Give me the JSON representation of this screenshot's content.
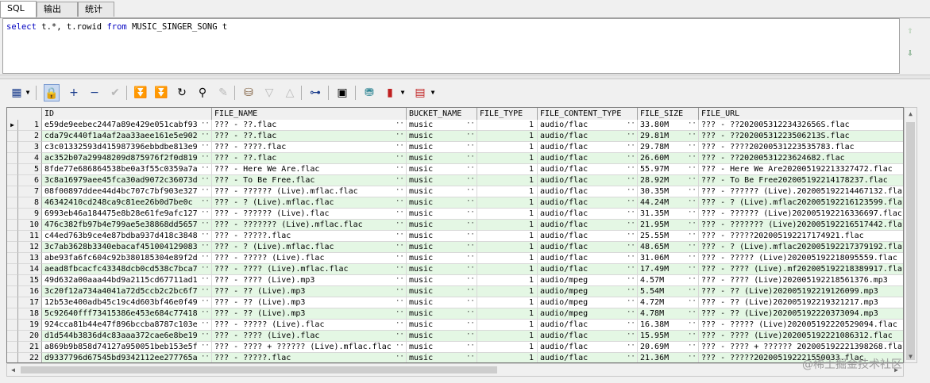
{
  "tabs": [
    "SQL",
    "输出",
    "统计"
  ],
  "sql": {
    "kw_select": "select",
    "part1": " t.*, t.rowid ",
    "kw_from": "from",
    "part2": " MUSIC_SINGER_SONG t"
  },
  "editor_icons": [
    "up-arrow-icon",
    "down-arrow-icon"
  ],
  "colors": {
    "accent": "#2a7a3a",
    "row_alt": "#e4f7e4",
    "keyword": "#0000c0"
  },
  "columns": [
    "ID",
    "FILE_NAME",
    "BUCKET_NAME",
    "FILE_TYPE",
    "FILE_CONTENT_TYPE",
    "FILE_SIZE",
    "FILE_URL"
  ],
  "rows": [
    [
      "1",
      "e59de9eebec2447a89e429e051cabf93",
      "??? - ??.flac",
      "music",
      "1",
      "audio/flac",
      "33.80M",
      "??? - ??20200531223432656S.flac"
    ],
    [
      "2",
      "cda79c440f1a4af2aa33aee161e5e902",
      "??? - ??.flac",
      "music",
      "1",
      "audio/flac",
      "29.81M",
      "??? - ??20200531223506213S.flac"
    ],
    [
      "3",
      "c3c01332593d415987396ebbdbe813e9",
      "??? - ????.flac",
      "music",
      "1",
      "audio/flac",
      "29.78M",
      "??? - ????20200531223535783.flac"
    ],
    [
      "4",
      "ac352b07a29948209d875976f2f0d819",
      "??? - ??.flac",
      "music",
      "1",
      "audio/flac",
      "26.60M",
      "??? - ??20200531223624682.flac"
    ],
    [
      "5",
      "8fde77e686864538be0a3f55c0359a7a",
      "??? - Here We Are.flac",
      "music",
      "1",
      "audio/flac",
      "55.97M",
      "??? - Here We Are202005192213327472.flac"
    ],
    [
      "6",
      "3c8a16979aee45fca30ad9072c36073d",
      "??? - To Be Free.flac",
      "music",
      "1",
      "audio/flac",
      "28.92M",
      "??? - To Be Free202005192214178237.flac"
    ],
    [
      "7",
      "08f00897ddee44d4bc707c7bf903e327",
      "??? - ?????? (Live).mflac.flac",
      "music",
      "1",
      "audio/flac",
      "30.35M",
      "??? - ?????? (Live).202005192214467132.fla"
    ],
    [
      "8",
      "46342410cd248ca9c81ee26b0d7be0c",
      "??? - ? (Live).mflac.flac",
      "music",
      "1",
      "audio/flac",
      "44.24M",
      "??? - ? (Live).mflac202005192216123599.fla"
    ],
    [
      "9",
      "6993eb46a184475e8b28e61fe9afc127",
      "??? - ?????? (Live).flac",
      "music",
      "1",
      "audio/flac",
      "31.35M",
      "??? - ?????? (Live)202005192216336697.flac"
    ],
    [
      "10",
      "476c382fb97b4e799ae5e38868dd5657",
      "??? - ??????? (Live).mflac.flac",
      "music",
      "1",
      "audio/flac",
      "21.95M",
      "??? - ??????? (Live)202005192216517442.fla"
    ],
    [
      "11",
      "c44ed763b9ce4e87bdba937d418c3848",
      "??? - ?????.flac",
      "music",
      "1",
      "audio/flac",
      "25.55M",
      "??? - ?????202005192217174921.flac"
    ],
    [
      "12",
      "3c7ab3628b3340ebacaf451004129083",
      "??? - ? (Live).mflac.flac",
      "music",
      "1",
      "audio/flac",
      "48.65M",
      "??? - ? (Live).mflac202005192217379192.fla"
    ],
    [
      "13",
      "abe93fa6fc604c92b380185304e89f2d",
      "??? - ????? (Live).flac",
      "music",
      "1",
      "audio/flac",
      "31.06M",
      "??? - ????? (Live)202005192218095559.flac"
    ],
    [
      "14",
      "aead8fbcacfc43348dcb0cd538c7bca7",
      "??? - ???? (Live).mflac.flac",
      "music",
      "1",
      "audio/flac",
      "17.49M",
      "??? - ???? (Live).mf202005192218389917.fla"
    ],
    [
      "15",
      "49d632a00aaa44bd9a2115cd67711ad1",
      "??? - ???? (Live).mp3",
      "music",
      "1",
      "audio/mpeg",
      "4.57M",
      "??? - ???? (Live)202005192218561376.mp3"
    ],
    [
      "16",
      "3c20f12a734a4041a72d5ccb2c2bc6f7",
      "??? - ?? (Live).mp3",
      "music",
      "1",
      "audio/mpeg",
      "5.54M",
      "??? - ?? (Live)202005192219126099.mp3"
    ],
    [
      "17",
      "12b53e400adb45c19c4d603bf46e0f49",
      "??? - ?? (Live).mp3",
      "music",
      "1",
      "audio/mpeg",
      "4.72M",
      "??? - ?? (Live)202005192219321217.mp3"
    ],
    [
      "18",
      "5c92640fff73415386e453e684c77418",
      "??? - ?? (Live).mp3",
      "music",
      "1",
      "audio/mpeg",
      "4.78M",
      "??? - ?? (Live)202005192220373094.mp3"
    ],
    [
      "19",
      "924cca81b44e47f896bccba8787c103e",
      "??? - ????? (Live).flac",
      "music",
      "1",
      "audio/flac",
      "16.38M",
      "??? - ????? (Live)202005192220529094.flac"
    ],
    [
      "20",
      "d1d544b3836d4c83aaa372cae6e8be19",
      "??? - ???? (Live).flac",
      "music",
      "1",
      "audio/flac",
      "15.95M",
      "??? - ???? (Live)202005192221086312.flac"
    ],
    [
      "21",
      "a869b9b858d74127a950051beb153e5f",
      "??? - ???? + ?????? (Live).mflac.flac",
      "music",
      "1",
      "audio/flac",
      "20.69M",
      "??? - ???? + ?????? 202005192221398268.fla"
    ],
    [
      "22",
      "d9337796d67545bd9342112ee277765a",
      "??? - ?????.flac",
      "music",
      "1",
      "audio/flac",
      "21.36M",
      "??? - ?????202005192221550033.flac"
    ]
  ],
  "watermark": "@稀土掘金技术社区"
}
